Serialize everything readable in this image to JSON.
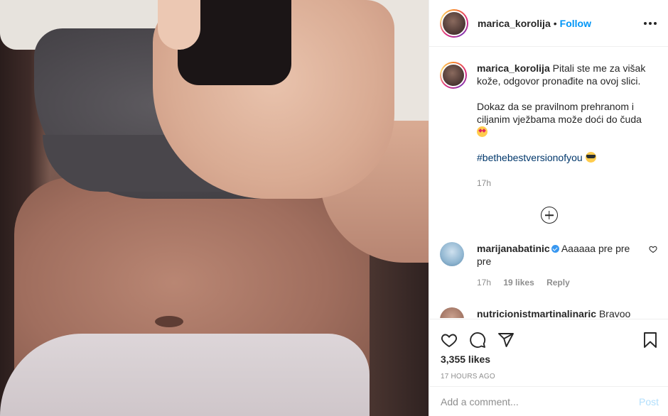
{
  "post": {
    "username": "marica_korolija",
    "follow_label": "Follow",
    "separator": "•",
    "caption": {
      "username": "marica_korolija",
      "line1": "Pitali ste me za višak kože, odgovor pronađite na ovoj slici.",
      "line2": "Dokaz da se pravilnom prehranom i ciljanim vježbama može doći do čuda",
      "line2_emoji": "smiling-face-with-heart-eyes",
      "hashtag": "#bethebestversionofyou",
      "hashtag_emoji": "smiling-face-with-sunglasses",
      "age": "17h"
    },
    "comments": [
      {
        "username": "marijanabatinic",
        "verified": true,
        "text": "Aaaaaa pre pre pre",
        "age": "17h",
        "likes": "19 likes",
        "reply_label": "Reply"
      },
      {
        "username": "nutricionistmartinalinaric",
        "text": "Bravoo"
      }
    ],
    "likes_count": "3,355 likes",
    "timestamp": "17 HOURS AGO"
  },
  "compose": {
    "placeholder": "Add a comment...",
    "post_label": "Post"
  },
  "colors": {
    "link": "#0095f6",
    "text": "#262626",
    "muted": "#8e8e8e",
    "hashtag": "#00376b",
    "post_disabled": "#b2dffc"
  },
  "icons": [
    "more-options-icon",
    "load-more-comments-icon",
    "heart-icon",
    "comment-icon",
    "share-icon",
    "bookmark-icon",
    "verified-badge-icon"
  ]
}
